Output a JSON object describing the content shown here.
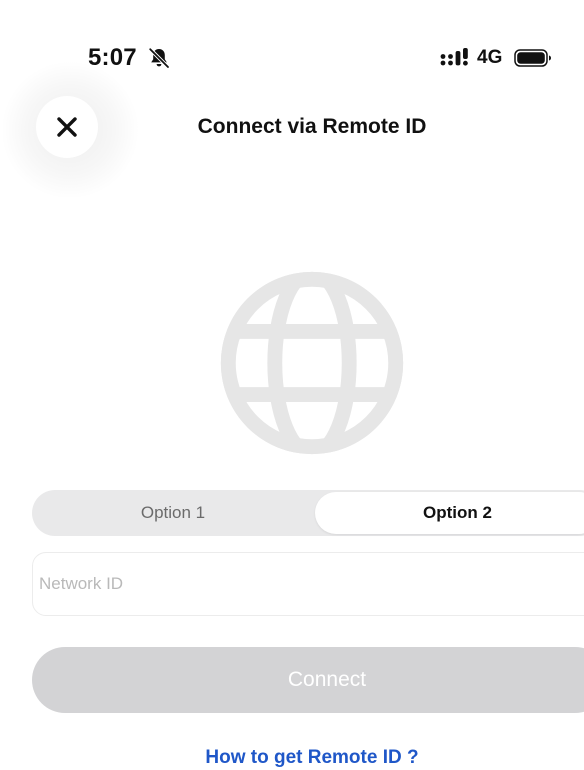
{
  "status_bar": {
    "time": "5:07",
    "network": "4G",
    "icons": [
      "bell-slash-icon",
      "signal-icon",
      "battery-icon"
    ]
  },
  "header": {
    "title": "Connect via Remote ID",
    "close_icon": "close-icon"
  },
  "hero": {
    "icon": "globe-icon",
    "color": "#e6e6e6"
  },
  "segmented_control": {
    "options": [
      "Option 1",
      "Option 2"
    ],
    "selected": "Option 2"
  },
  "form": {
    "network_id_placeholder": "Network ID",
    "network_id_value": ""
  },
  "actions": {
    "connect_label": "Connect",
    "help_link": "How to get Remote ID ?"
  },
  "colors": {
    "link": "#1f57c8",
    "disabled_button": "#d3d3d5",
    "segment_track": "#e9e9ea"
  }
}
